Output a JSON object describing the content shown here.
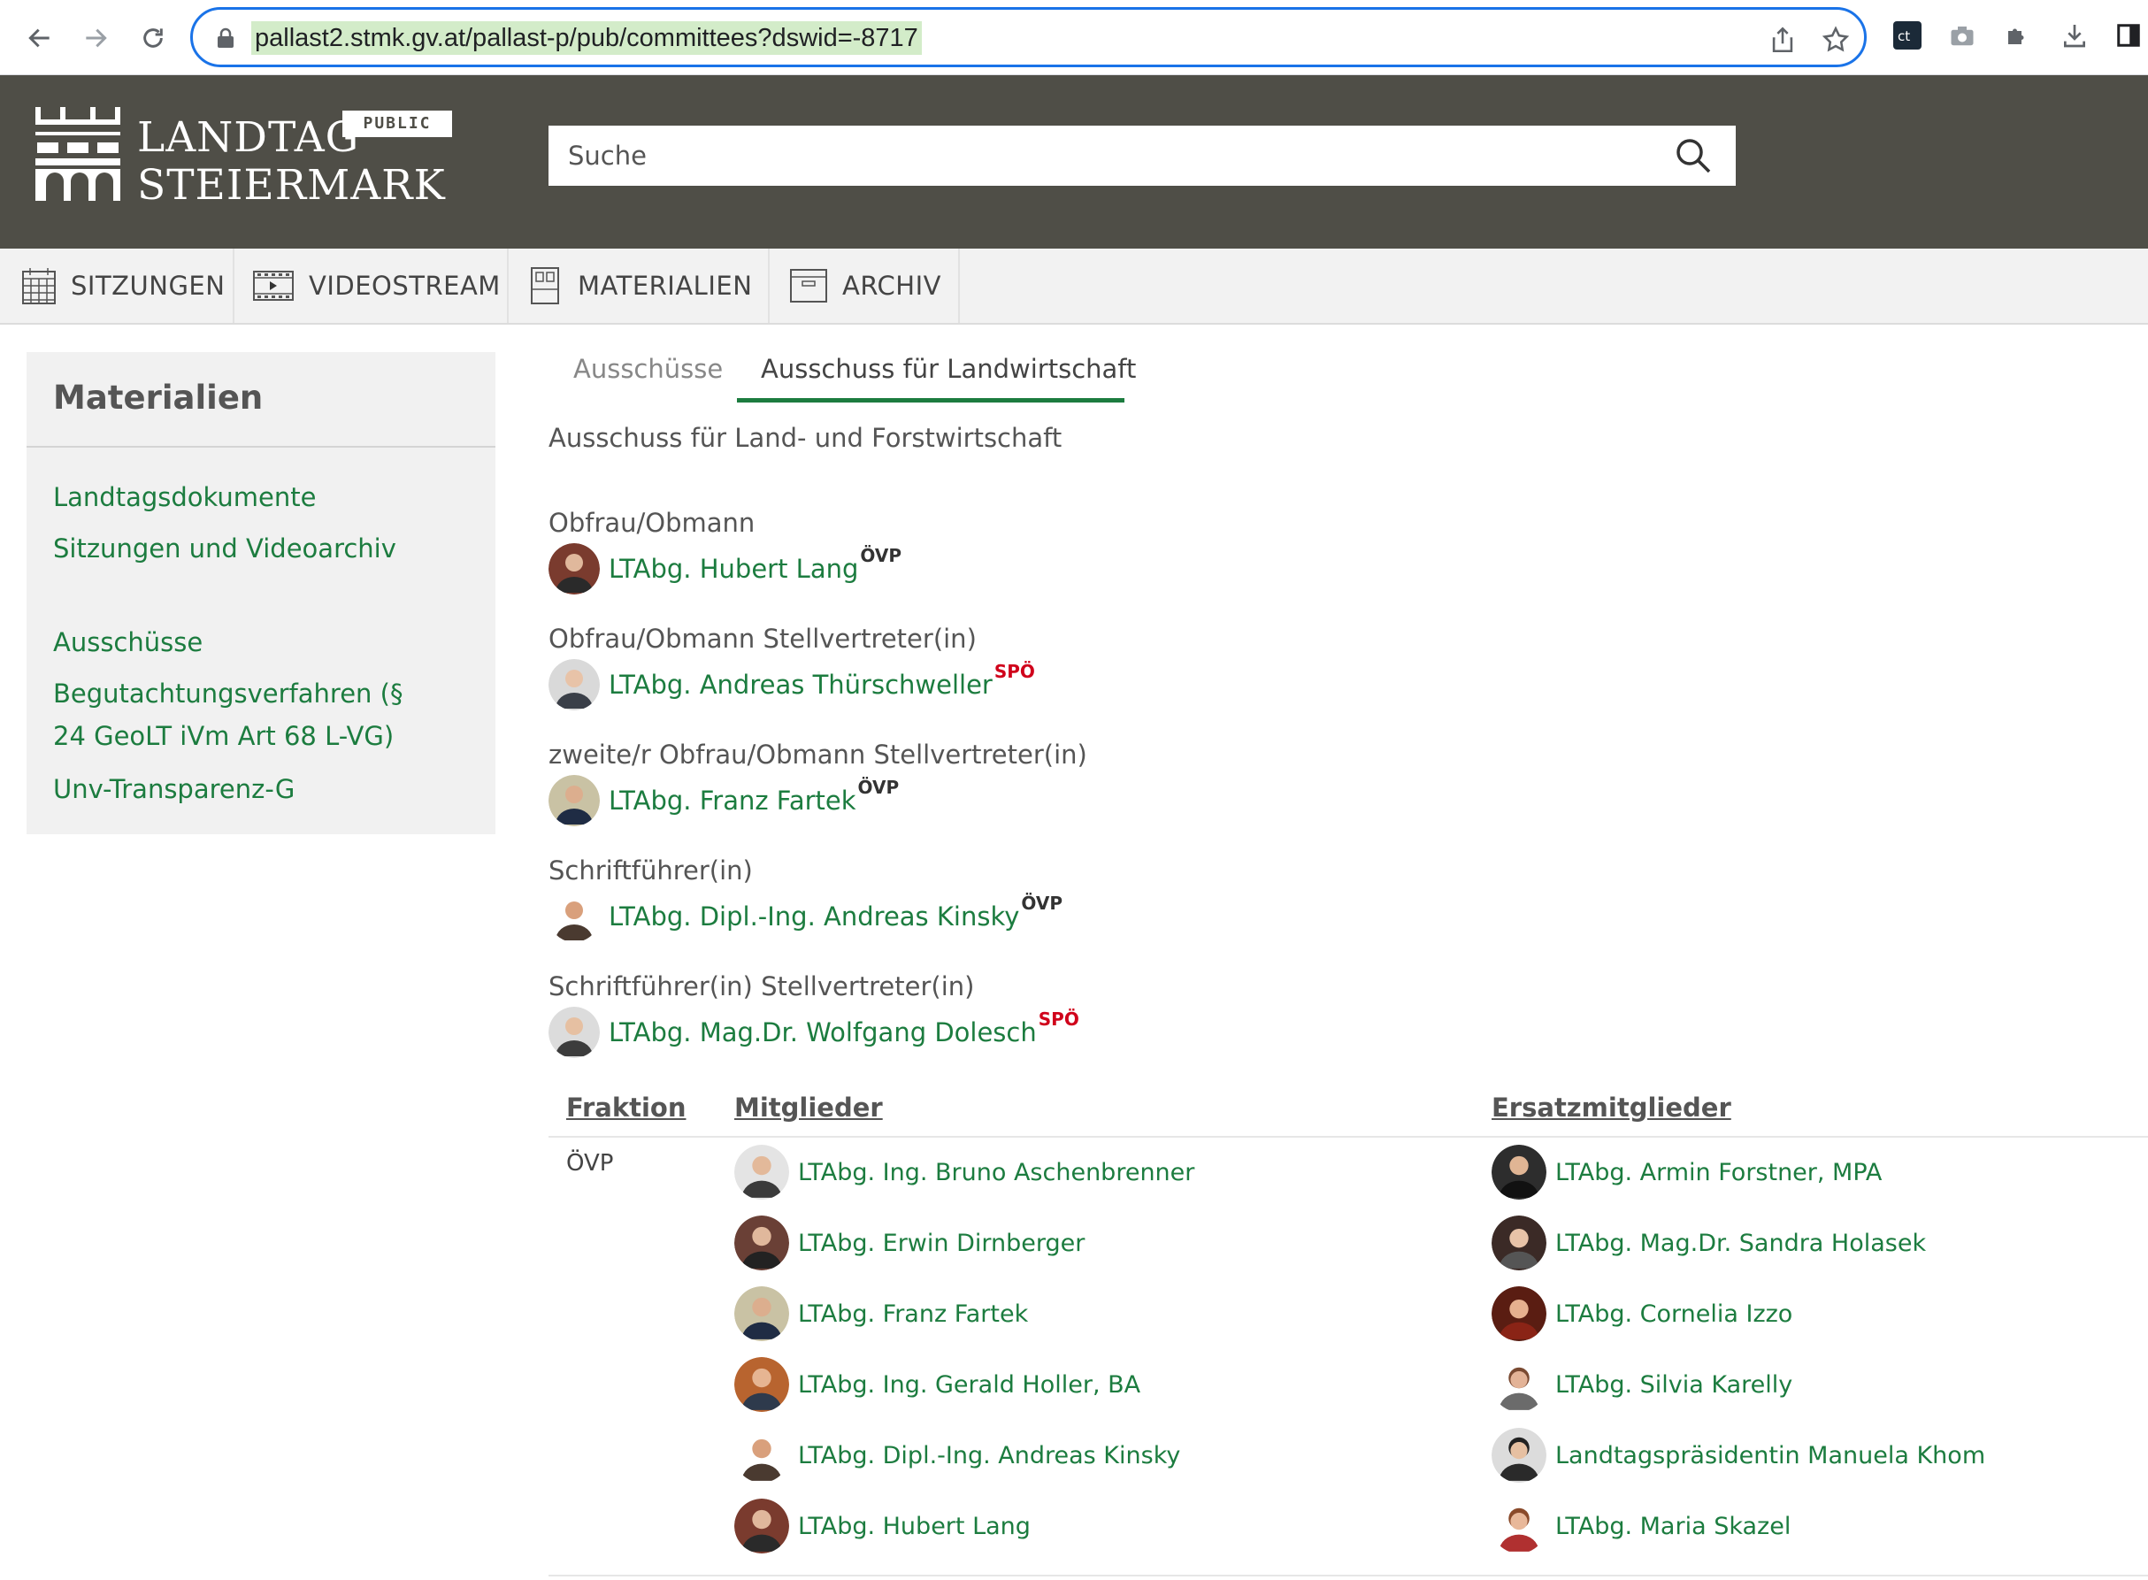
{
  "browser": {
    "url": "pallast2.stmk.gv.at/pallast-p/pub/committees?dswid=-8717"
  },
  "header": {
    "logo_line1": "LANDTAG",
    "logo_line2": "STEIERMARK",
    "badge": "PUBLIC",
    "search_placeholder": "Suche"
  },
  "nav": {
    "items": [
      {
        "label": "SITZUNGEN",
        "icon": "calendar-icon"
      },
      {
        "label": "VIDEOSTREAM",
        "icon": "film-icon"
      },
      {
        "label": "MATERIALIEN",
        "icon": "document-icon"
      },
      {
        "label": "ARCHIV",
        "icon": "archive-box-icon"
      }
    ]
  },
  "sidebar": {
    "title": "Materialien",
    "links": [
      "Landtagsdokumente",
      "Sitzungen und Videoarchiv",
      "Ausschüsse",
      "Begutachtungsverfahren (§ 24 GeoLT iVm Art 68 L-VG)",
      "Unv-Transparenz-G"
    ]
  },
  "content": {
    "tabs": [
      "Ausschüsse",
      "Ausschuss für Landwirtschaft"
    ],
    "subtitle": "Ausschuss für Land- und Forstwirtschaft",
    "roles": [
      {
        "label": "Obfrau/Obmann",
        "name": "LTAbg. Hubert Lang",
        "party": "ÖVP"
      },
      {
        "label": "Obfrau/Obmann Stellvertreter(in)",
        "name": "LTAbg. Andreas Thürschweller",
        "party": "SPÖ"
      },
      {
        "label": "zweite/r Obfrau/Obmann Stellvertreter(in)",
        "name": "LTAbg. Franz Fartek",
        "party": "ÖVP"
      },
      {
        "label": "Schriftführer(in)",
        "name": "LTAbg. Dipl.-Ing. Andreas Kinsky",
        "party": "ÖVP"
      },
      {
        "label": "Schriftführer(in) Stellvertreter(in)",
        "name": "LTAbg. Mag.Dr. Wolfgang Dolesch",
        "party": "SPÖ"
      }
    ],
    "table": {
      "headers": [
        "Fraktion",
        "Mitglieder",
        "Ersatzmitglieder"
      ],
      "fraktion": "ÖVP",
      "members": [
        "LTAbg. Ing. Bruno Aschenbrenner",
        "LTAbg. Erwin Dirnberger",
        "LTAbg. Franz Fartek",
        "LTAbg. Ing. Gerald Holler, BA",
        "LTAbg. Dipl.-Ing. Andreas Kinsky",
        "LTAbg. Hubert Lang"
      ],
      "substitutes": [
        "LTAbg. Armin Forstner, MPA",
        "LTAbg. Mag.Dr. Sandra Holasek",
        "LTAbg. Cornelia Izzo",
        "LTAbg. Silvia Karelly",
        "Landtagspräsidentin Manuela Khom",
        "LTAbg. Maria Skazel"
      ]
    }
  },
  "colors": {
    "header_bg": "#4f4e47",
    "link_green": "#1c7c3f",
    "spoe_red": "#d0021b",
    "focus_blue": "#1a73e8"
  }
}
